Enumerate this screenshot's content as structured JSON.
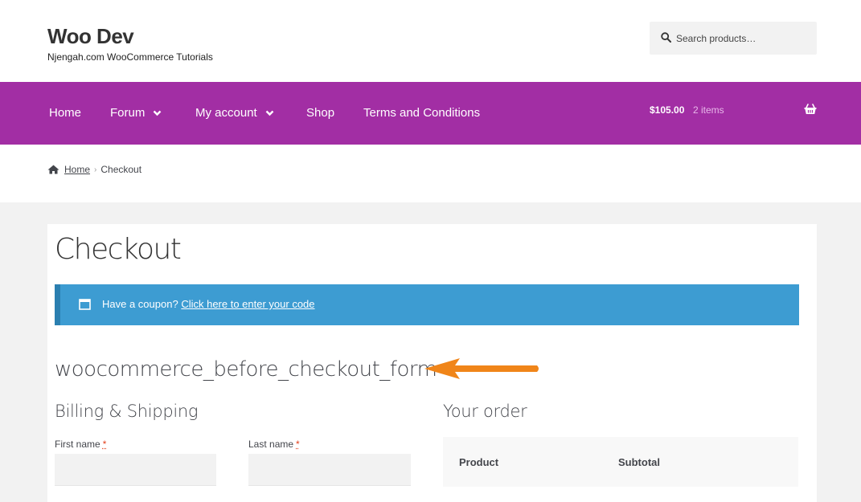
{
  "site": {
    "title": "Woo Dev",
    "tagline": "Njengah.com WooCommerce Tutorials"
  },
  "search": {
    "placeholder": "Search products…",
    "icon": "search-icon"
  },
  "nav": {
    "items": [
      {
        "label": "Home",
        "dropdown": false
      },
      {
        "label": "Forum",
        "dropdown": true
      },
      {
        "label": "My account",
        "dropdown": true
      },
      {
        "label": "Shop",
        "dropdown": false
      },
      {
        "label": "Terms and Conditions",
        "dropdown": false
      }
    ],
    "background": "#a22ea4"
  },
  "cart": {
    "amount": "$105.00",
    "count": "2 items",
    "icon": "basket-icon"
  },
  "breadcrumb": {
    "home": "Home",
    "current": "Checkout"
  },
  "page": {
    "title": "Checkout"
  },
  "coupon": {
    "prompt": "Have a coupon?",
    "link": "Click here to enter your code",
    "color": "#3d9cd2"
  },
  "hook": {
    "label": "woocommerce_before_checkout_form",
    "arrow_color": "#f08519"
  },
  "billing": {
    "title": "Billing & Shipping",
    "first_name_label": "First name",
    "last_name_label": "Last name",
    "required_mark": "*"
  },
  "order": {
    "title": "Your order",
    "col_product": "Product",
    "col_subtotal": "Subtotal"
  }
}
